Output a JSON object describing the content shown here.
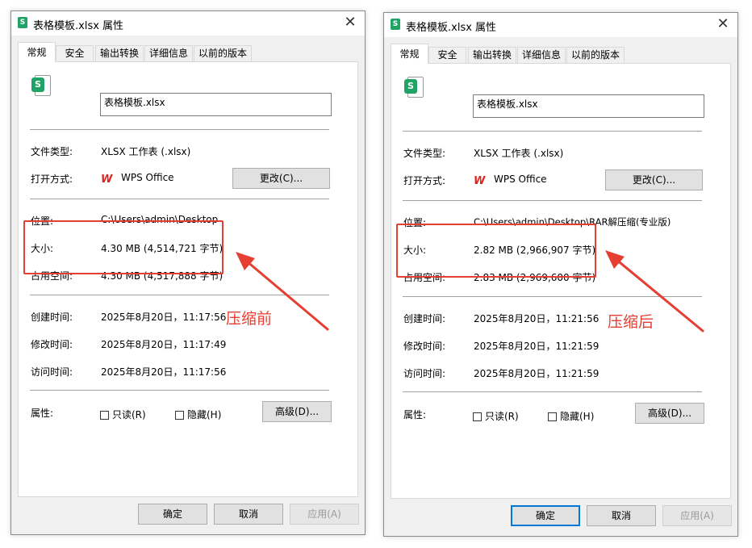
{
  "colors": {
    "annotation": "#e43f32",
    "xlsx_icon": "#21a366",
    "wps_icon": "#e0211d",
    "primary_border": "#0078d7"
  },
  "icons": {
    "title": "spreadsheet-s-icon",
    "file": "spreadsheet-s-icon",
    "app": "wps-w-icon",
    "close": "close-x-icon",
    "checkbox": "checkbox-unchecked-icon"
  },
  "dialogs": [
    {
      "title": "表格模板.xlsx 属性",
      "close_glyph": "✕",
      "icon_letter": "S",
      "tabs": [
        "常规",
        "安全",
        "输出转换",
        "详细信息",
        "以前的版本"
      ],
      "active_tab": 0,
      "file_name": "表格模板.xlsx",
      "labels": {
        "file_type": "文件类型:",
        "open_with": "打开方式:",
        "location": "位置:",
        "size": "大小:",
        "size_on_disk": "占用空间:",
        "created": "创建时间:",
        "modified": "修改时间:",
        "accessed": "访问时间:",
        "attributes": "属性:"
      },
      "values": {
        "file_type": "XLSX 工作表 (.xlsx)",
        "open_with": "WPS Office",
        "location": "C:\\Users\\admin\\Desktop",
        "size": "4.30 MB (4,514,721 字节)",
        "size_on_disk": "4.30 MB (4,517,888 字节)",
        "created": "2025年8月20日，11:17:56",
        "modified": "2025年8月20日，11:17:49",
        "accessed": "2025年8月20日，11:17:56"
      },
      "wps_glyph": "W",
      "change_button": "更改(C)...",
      "readonly_label": "只读(R)",
      "hidden_label": "隐藏(H)",
      "advanced_button": "高级(D)...",
      "ok_button": "确定",
      "cancel_button": "取消",
      "apply_button": "应用(A)",
      "annotation": "压缩前"
    },
    {
      "title": "表格模板.xlsx 属性",
      "close_glyph": "✕",
      "icon_letter": "S",
      "tabs": [
        "常规",
        "安全",
        "输出转换",
        "详细信息",
        "以前的版本"
      ],
      "active_tab": 0,
      "file_name": "表格模板.xlsx",
      "labels": {
        "file_type": "文件类型:",
        "open_with": "打开方式:",
        "location": "位置:",
        "size": "大小:",
        "size_on_disk": "占用空间:",
        "created": "创建时间:",
        "modified": "修改时间:",
        "accessed": "访问时间:",
        "attributes": "属性:"
      },
      "values": {
        "file_type": "XLSX 工作表 (.xlsx)",
        "open_with": "WPS Office",
        "location": "C:\\Users\\admin\\Desktop\\RAR解压缩(专业版)",
        "size": "2.82 MB (2,966,907 字节)",
        "size_on_disk": "2.83 MB (2,969,600 字节)",
        "created": "2025年8月20日，11:21:56",
        "modified": "2025年8月20日，11:21:59",
        "accessed": "2025年8月20日，11:21:59"
      },
      "wps_glyph": "W",
      "change_button": "更改(C)...",
      "readonly_label": "只读(R)",
      "hidden_label": "隐藏(H)",
      "advanced_button": "高级(D)...",
      "ok_button": "确定",
      "cancel_button": "取消",
      "apply_button": "应用(A)",
      "annotation": "压缩后"
    }
  ]
}
